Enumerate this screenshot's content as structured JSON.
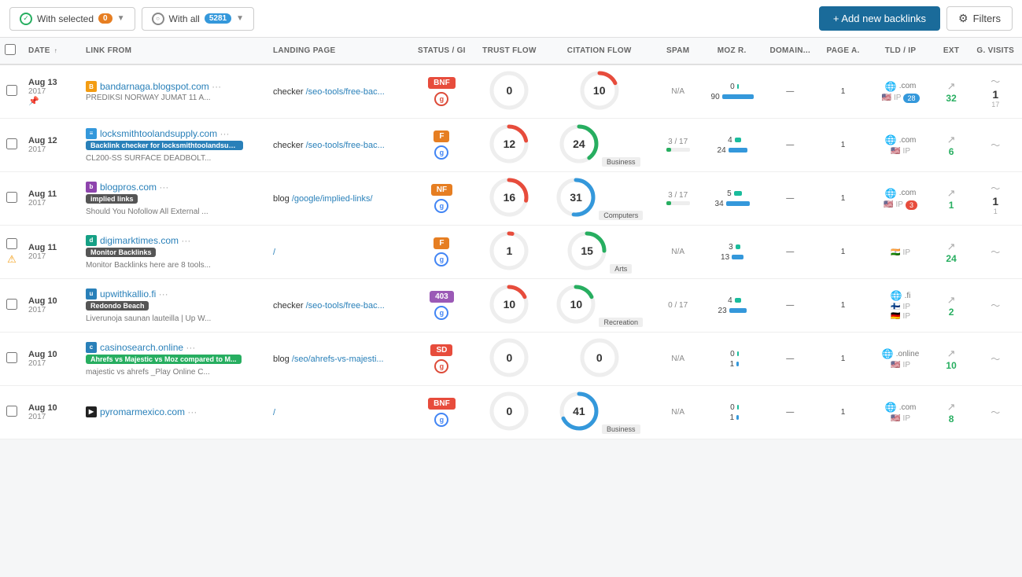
{
  "toolbar": {
    "with_selected_label": "With selected",
    "with_selected_count": "0",
    "with_all_label": "With all",
    "with_all_count": "5281",
    "add_backlinks_label": "+ Add new backlinks",
    "filters_label": "Filters"
  },
  "table": {
    "headers": [
      {
        "key": "checkbox",
        "label": ""
      },
      {
        "key": "date",
        "label": "DATE"
      },
      {
        "key": "link_from",
        "label": "LINK FROM"
      },
      {
        "key": "landing_page",
        "label": "LANDING PAGE"
      },
      {
        "key": "status_gi",
        "label": "STATUS / GI"
      },
      {
        "key": "trust_flow",
        "label": "TRUST FLOW"
      },
      {
        "key": "citation_flow",
        "label": "CITATION FLOW"
      },
      {
        "key": "spam",
        "label": "SPAM"
      },
      {
        "key": "moz_r",
        "label": "MOZ R."
      },
      {
        "key": "domain",
        "label": "DOMAIN..."
      },
      {
        "key": "page_a",
        "label": "PAGE A."
      },
      {
        "key": "tld_ip",
        "label": "TLD / IP"
      },
      {
        "key": "ext",
        "label": "EXT"
      },
      {
        "key": "g_visits",
        "label": "G. VISITS"
      }
    ],
    "rows": [
      {
        "id": 1,
        "date_main": "Aug 13",
        "date_year": "2017",
        "domain": "bandarnaga.blogspot.com",
        "domain_suffix": "···",
        "favicon_color": "#f39c12",
        "favicon_char": "B",
        "tag": null,
        "snippet": "PREDIKSI NORWAY JUMAT 11 A...",
        "has_pin": true,
        "landing_page": "checker /seo-tools/free-bac...",
        "status": "BNF",
        "status_class": "s-bnf",
        "google_type": "plus",
        "trust_flow": 0,
        "trust_arc_pct": 0,
        "trust_color": "#e74c3c",
        "citation_flow": 10,
        "citation_arc_pct": 18,
        "citation_color": "#e74c3c",
        "category": null,
        "spam": "N/A",
        "spam_pct": 0,
        "spam_color": "none",
        "moz_val1": 0,
        "moz_bar1_w": 2,
        "moz_val2": 90,
        "moz_bar2_w": 40,
        "page_a": 1,
        "tld": ".com",
        "flag": "🇺🇸",
        "flag2": null,
        "ip_num": "28",
        "ip_color": "#3498db",
        "ext_val": "32",
        "g_visits": "1",
        "g_sub": "17",
        "warn": false
      },
      {
        "id": 2,
        "date_main": "Aug 12",
        "date_year": "2017",
        "domain": "locksmithtoolandsupply.com",
        "domain_suffix": "···",
        "favicon_color": "#3498db",
        "favicon_char": "≡",
        "tag_text": "Backlink checker for locksmithtoolandsuppl...",
        "tag_class": "tag-blue",
        "snippet": "CL200-SS SURFACE DEADBOLT...",
        "has_pin": false,
        "landing_page": "checker /seo-tools/free-bac...",
        "status": "F",
        "status_class": "s-f",
        "google_type": "normal",
        "trust_flow": 12,
        "trust_arc_pct": 22,
        "trust_color": "#e74c3c",
        "citation_flow": 24,
        "citation_arc_pct": 40,
        "citation_color": "#27ae60",
        "category": "Business",
        "spam": "3 / 17",
        "spam_pct": 20,
        "spam_color": "green",
        "moz_val1": 4,
        "moz_bar1_w": 8,
        "moz_val2": 24,
        "moz_bar2_w": 24,
        "page_a": 1,
        "tld": ".com",
        "flag": "🇺🇸",
        "flag2": null,
        "ip_num": null,
        "ip_color": null,
        "ext_val": "6",
        "g_visits": "",
        "g_sub": "",
        "warn": false
      },
      {
        "id": 3,
        "date_main": "Aug 11",
        "date_year": "2017",
        "domain": "blogpros.com",
        "domain_suffix": "···",
        "favicon_color": "#8e44ad",
        "favicon_char": "b",
        "tag_text": "implied links",
        "tag_class": "tag-dark",
        "snippet": "Should You Nofollow All External ...",
        "has_pin": false,
        "landing_page": "blog /google/implied-links/",
        "status": "NF",
        "status_class": "s-nf",
        "google_type": "normal",
        "trust_flow": 16,
        "trust_arc_pct": 28,
        "trust_color": "#e74c3c",
        "citation_flow": 31,
        "citation_arc_pct": 52,
        "citation_color": "#3498db",
        "category": "Computers",
        "spam": "3 / 17",
        "spam_pct": 20,
        "spam_color": "green",
        "moz_val1": 5,
        "moz_bar1_w": 10,
        "moz_val2": 34,
        "moz_bar2_w": 30,
        "page_a": 1,
        "tld": ".com",
        "flag": "🇺🇸",
        "flag2": null,
        "ip_num": "3",
        "ip_color": "#e74c3c",
        "ext_val": "1",
        "g_visits": "1",
        "g_sub": "1",
        "warn": false
      },
      {
        "id": 4,
        "date_main": "Aug 11",
        "date_year": "2017",
        "domain": "digimarktimes.com",
        "domain_suffix": "···",
        "favicon_color": "#16a085",
        "favicon_char": "d",
        "tag_text": "Monitor Backlinks",
        "tag_class": "tag-dark",
        "snippet": "Monitor Backlinks here are 8 tools...",
        "has_pin": false,
        "landing_page": "/",
        "status": "F",
        "status_class": "s-f",
        "google_type": "normal",
        "trust_flow": 1,
        "trust_arc_pct": 3,
        "trust_color": "#e74c3c",
        "citation_flow": 15,
        "citation_arc_pct": 25,
        "citation_color": "#27ae60",
        "category": "Arts",
        "spam": "N/A",
        "spam_pct": 0,
        "spam_color": "none",
        "moz_val1": 3,
        "moz_bar1_w": 6,
        "moz_val2": 13,
        "moz_bar2_w": 15,
        "page_a": 1,
        "tld": null,
        "flag": "🇮🇳",
        "flag2": null,
        "ip_num": null,
        "ip_color": null,
        "ext_val": "24",
        "g_visits": "",
        "g_sub": "",
        "warn": true
      },
      {
        "id": 5,
        "date_main": "Aug 10",
        "date_year": "2017",
        "domain": "upwithkallio.fi",
        "domain_suffix": "···",
        "favicon_color": "#2980b9",
        "favicon_char": "u",
        "tag_text": "Redondo Beach",
        "tag_class": "tag-dark",
        "snippet": "Liverunoja saunan lauteilla | Up W...",
        "has_pin": false,
        "landing_page": "checker /seo-tools/free-bac...",
        "status": "403",
        "status_class": "s-403",
        "google_type": "normal",
        "trust_flow": 10,
        "trust_arc_pct": 18,
        "trust_color": "#e74c3c",
        "citation_flow": 10,
        "citation_arc_pct": 18,
        "citation_color": "#27ae60",
        "category": "Recreation",
        "spam": "0 / 17",
        "spam_pct": 0,
        "spam_color": "green",
        "moz_val1": 4,
        "moz_bar1_w": 8,
        "moz_val2": 23,
        "moz_bar2_w": 22,
        "page_a": 1,
        "tld": ".fi",
        "flag": "🇩🇪",
        "flag2": "🇫🇮",
        "ip_num": null,
        "ip_color": null,
        "ext_val": "2",
        "g_visits": "",
        "g_sub": "",
        "warn": false
      },
      {
        "id": 6,
        "date_main": "Aug 10",
        "date_year": "2017",
        "domain": "casinosearch.online",
        "domain_suffix": "···",
        "favicon_color": "#2980b9",
        "favicon_char": "c",
        "tag_text": "Ahrefs vs Majestic vs Moz compared to M...",
        "tag_class": "tag-green",
        "snippet": "majestic vs ahrefs _Play Online C...",
        "has_pin": false,
        "landing_page": "blog /seo/ahrefs-vs-majesti...",
        "status": "SD",
        "status_class": "s-sd",
        "google_type": "plus",
        "trust_flow": 0,
        "trust_arc_pct": 0,
        "trust_color": "#e74c3c",
        "citation_flow": 0,
        "citation_arc_pct": 0,
        "citation_color": "#27ae60",
        "category": null,
        "spam": "N/A",
        "spam_pct": 0,
        "spam_color": "none",
        "moz_val1": 0,
        "moz_bar1_w": 2,
        "moz_val2": 1,
        "moz_bar2_w": 3,
        "page_a": 1,
        "tld": ".online",
        "flag": "🇺🇸",
        "flag2": null,
        "ip_num": null,
        "ip_color": null,
        "ext_val": "10",
        "g_visits": "",
        "g_sub": "",
        "warn": false
      },
      {
        "id": 7,
        "date_main": "Aug 10",
        "date_year": "2017",
        "domain": "pyromarmexico.com",
        "domain_suffix": "···",
        "favicon_color": "#222",
        "favicon_char": "▶",
        "tag": null,
        "snippet": "",
        "has_pin": false,
        "landing_page": "/",
        "status": "BNF",
        "status_class": "s-bnf",
        "google_type": "normal",
        "trust_flow": 0,
        "trust_arc_pct": 0,
        "trust_color": "#e74c3c",
        "citation_flow": 41,
        "citation_arc_pct": 68,
        "citation_color": "#3498db",
        "category": "Business",
        "spam": "N/A",
        "spam_pct": 0,
        "spam_color": "none",
        "moz_val1": 0,
        "moz_bar1_w": 2,
        "moz_val2": 1,
        "moz_bar2_w": 3,
        "page_a": 1,
        "tld": ".com",
        "flag": "🇺🇸",
        "flag2": null,
        "ip_num": null,
        "ip_color": null,
        "ext_val": "8",
        "g_visits": "",
        "g_sub": "",
        "warn": false
      }
    ]
  }
}
